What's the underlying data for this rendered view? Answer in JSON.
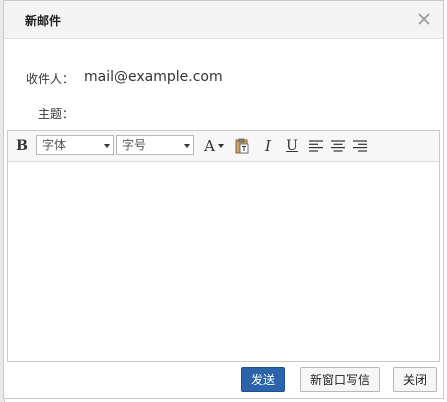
{
  "dialog": {
    "title": "新邮件",
    "close_icon": "close-x-icon"
  },
  "form": {
    "recipient_label": "收件人：",
    "recipient_value": "mail@example.com",
    "subject_label": "主题：",
    "subject_value": "",
    "subject_placeholder": ""
  },
  "toolbar": {
    "bold_label": "B",
    "font_select_value": "字体",
    "size_select_value": "字号",
    "font_color_label": "A",
    "italic_label": "I",
    "underline_label": "U",
    "icons": [
      "bold-icon",
      "font-select",
      "size-select",
      "font-color-icon",
      "paste-text-icon",
      "italic-icon",
      "underline-icon",
      "align-left-icon",
      "align-center-icon",
      "align-right-icon"
    ]
  },
  "editor": {
    "body": ""
  },
  "footer": {
    "send_label": "发送",
    "new_window_label": "新窗口写信",
    "close_label": "关闭"
  },
  "colors": {
    "primary_button": "#2c64ac",
    "title_bar": "#f4f4f4",
    "toolbar_bg": "#f7f7f7",
    "border": "#c9c9c9"
  }
}
